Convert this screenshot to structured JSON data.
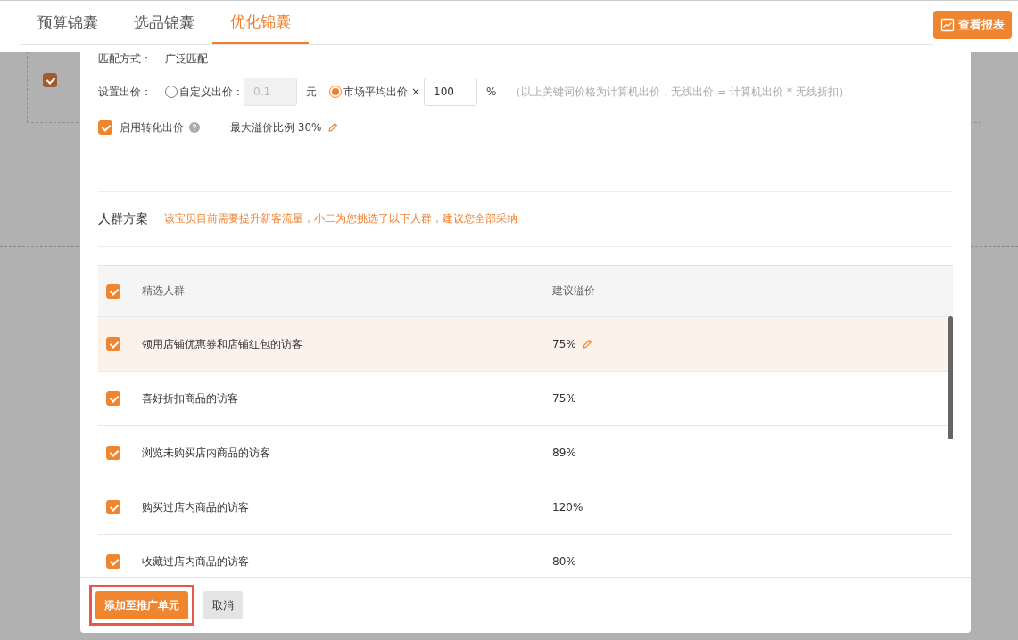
{
  "tabs": [
    {
      "label": "预算锦囊",
      "selected": false
    },
    {
      "label": "选品锦囊",
      "selected": false
    },
    {
      "label": "优化锦囊",
      "selected": true
    }
  ],
  "report_button": "查看报表",
  "background": {
    "checked": true
  },
  "match": {
    "label": "匹配方式：",
    "value": "广泛匹配"
  },
  "bid": {
    "label": "设置出价：",
    "options": [
      {
        "kind": "custom",
        "label": "自定义出价：",
        "selected": false,
        "placeholder": "0.1",
        "disabled": true,
        "unit": "元"
      },
      {
        "kind": "market",
        "label": "市场平均出价",
        "selected": true,
        "operator": "×",
        "value": "100",
        "disabled": false,
        "unit": "%"
      }
    ],
    "note": "（以上关键词价格为计算机出价，无线出价 = 计算机出价 * 无线折扣）"
  },
  "conversion": {
    "label": "启用转化出价",
    "checked": true,
    "max_label": "最大溢价比例 30%"
  },
  "crowd": {
    "title": "人群方案",
    "hint": "该宝贝目前需要提升新客流量，小二为您挑选了以下人群，建议您全部采纳"
  },
  "table": {
    "all_checked": true,
    "columns": [
      "精选人群",
      "建议溢价"
    ],
    "rows": [
      {
        "name": "领用店铺优惠券和店铺红包的访客",
        "premium": "75%",
        "checked": true,
        "selected": true
      },
      {
        "name": "喜好折扣商品的访客",
        "premium": "75%",
        "checked": true,
        "selected": false
      },
      {
        "name": "浏览未购买店内商品的访客",
        "premium": "89%",
        "checked": true,
        "selected": false
      },
      {
        "name": "购买过店内商品的访客",
        "premium": "120%",
        "checked": true,
        "selected": false
      },
      {
        "name": "收藏过店内商品的访客",
        "premium": "80%",
        "checked": true,
        "selected": false
      }
    ]
  },
  "footer": {
    "buttons": [
      {
        "label": "添加至推广单元",
        "kind": "primary",
        "highlighted": true
      },
      {
        "label": "取消",
        "kind": "secondary",
        "highlighted": false
      }
    ]
  }
}
